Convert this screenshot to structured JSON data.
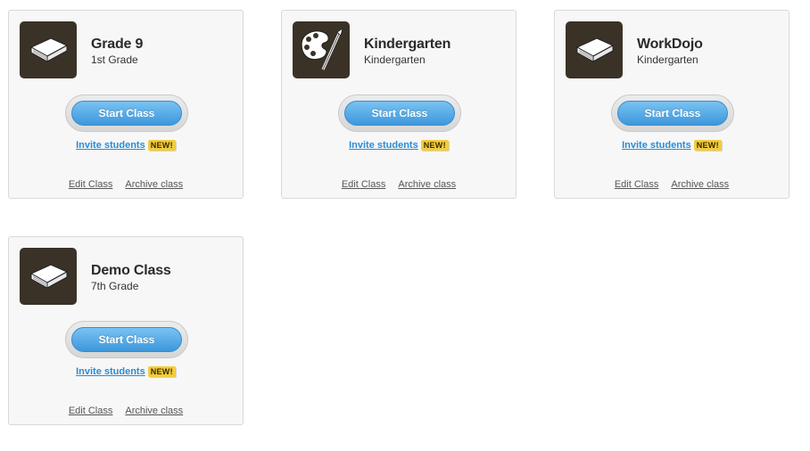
{
  "classes": [
    {
      "title": "Grade 9",
      "subtitle": "1st Grade",
      "icon": "book-icon",
      "start_label": "Start Class",
      "invite_label": "Invite students",
      "badge": "NEW!",
      "edit_label": "Edit Class",
      "archive_label": "Archive class"
    },
    {
      "title": "Kindergarten",
      "subtitle": "Kindergarten",
      "icon": "paint-palette-icon",
      "start_label": "Start Class",
      "invite_label": "Invite students",
      "badge": "NEW!",
      "edit_label": "Edit Class",
      "archive_label": "Archive class"
    },
    {
      "title": "WorkDojo",
      "subtitle": "Kindergarten",
      "icon": "book-icon",
      "start_label": "Start Class",
      "invite_label": "Invite students",
      "badge": "NEW!",
      "edit_label": "Edit Class",
      "archive_label": "Archive class"
    },
    {
      "title": "Demo Class",
      "subtitle": "7th Grade",
      "icon": "book-icon",
      "start_label": "Start Class",
      "invite_label": "Invite students",
      "badge": "NEW!",
      "edit_label": "Edit Class",
      "archive_label": "Archive class"
    }
  ],
  "colors": {
    "thumb_bg": "#3a3227",
    "start_button": "#4aa3e2",
    "invite_link": "#2a8bd4",
    "badge": "#f2cc3d"
  }
}
